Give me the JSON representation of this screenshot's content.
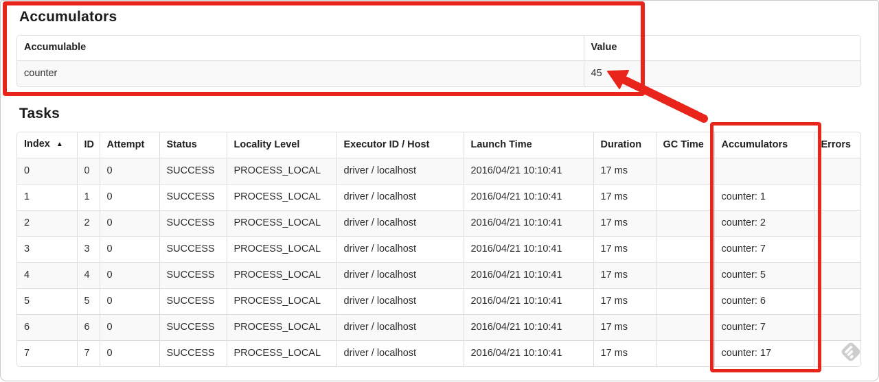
{
  "annotation_color": "#e8241b",
  "annotation_color_dark": "#c21508",
  "watermark_color": "#c9c9c9",
  "accumulators": {
    "title": "Accumulators",
    "headers": [
      "Accumulable",
      "Value"
    ],
    "rows": [
      [
        "counter",
        "45"
      ]
    ]
  },
  "tasks": {
    "title": "Tasks",
    "sort_icon": "▲",
    "headers": [
      "Index",
      "ID",
      "Attempt",
      "Status",
      "Locality Level",
      "Executor ID / Host",
      "Launch Time",
      "Duration",
      "GC Time",
      "Accumulators",
      "Errors"
    ],
    "rows": [
      [
        "0",
        "0",
        "0",
        "SUCCESS",
        "PROCESS_LOCAL",
        "driver / localhost",
        "2016/04/21 10:10:41",
        "17 ms",
        "",
        "",
        ""
      ],
      [
        "1",
        "1",
        "0",
        "SUCCESS",
        "PROCESS_LOCAL",
        "driver / localhost",
        "2016/04/21 10:10:41",
        "17 ms",
        "",
        "counter: 1",
        ""
      ],
      [
        "2",
        "2",
        "0",
        "SUCCESS",
        "PROCESS_LOCAL",
        "driver / localhost",
        "2016/04/21 10:10:41",
        "17 ms",
        "",
        "counter: 2",
        ""
      ],
      [
        "3",
        "3",
        "0",
        "SUCCESS",
        "PROCESS_LOCAL",
        "driver / localhost",
        "2016/04/21 10:10:41",
        "17 ms",
        "",
        "counter: 7",
        ""
      ],
      [
        "4",
        "4",
        "0",
        "SUCCESS",
        "PROCESS_LOCAL",
        "driver / localhost",
        "2016/04/21 10:10:41",
        "17 ms",
        "",
        "counter: 5",
        ""
      ],
      [
        "5",
        "5",
        "0",
        "SUCCESS",
        "PROCESS_LOCAL",
        "driver / localhost",
        "2016/04/21 10:10:41",
        "17 ms",
        "",
        "counter: 6",
        ""
      ],
      [
        "6",
        "6",
        "0",
        "SUCCESS",
        "PROCESS_LOCAL",
        "driver / localhost",
        "2016/04/21 10:10:41",
        "17 ms",
        "",
        "counter: 7",
        ""
      ],
      [
        "7",
        "7",
        "0",
        "SUCCESS",
        "PROCESS_LOCAL",
        "driver / localhost",
        "2016/04/21 10:10:41",
        "17 ms",
        "",
        "counter: 17",
        ""
      ]
    ]
  }
}
